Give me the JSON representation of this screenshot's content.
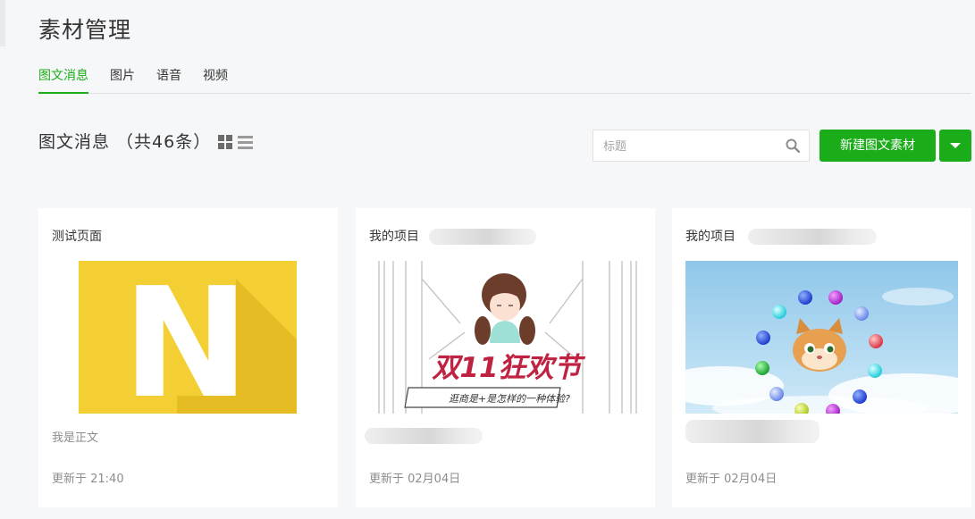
{
  "header": {
    "title": "素材管理"
  },
  "tabs": [
    {
      "label": "图文消息",
      "active": true
    },
    {
      "label": "图片",
      "active": false
    },
    {
      "label": "语音",
      "active": false
    },
    {
      "label": "视频",
      "active": false
    }
  ],
  "section": {
    "title": "图文消息 （共46条）"
  },
  "search": {
    "placeholder": "标题",
    "value": ""
  },
  "toolbar": {
    "new_label": "新建图文素材"
  },
  "colors": {
    "accent": "#1aad19"
  },
  "icons": {
    "grid": "grid-view-icon",
    "list": "list-view-icon",
    "search": "search-icon",
    "dropdown": "caret-down-icon"
  },
  "cards": [
    {
      "title": "测试页面",
      "digest": "我是正文",
      "time": "更新于 21:40",
      "cover_letter": "N"
    },
    {
      "title": "我的项目",
      "digest": "",
      "time": "更新于 02月04日",
      "cover_text": "双11狂欢节",
      "cover_subtext": "逛商是+是怎样的一种体验?"
    },
    {
      "title": "我的项目",
      "digest": "",
      "time": "更新于 02月04日"
    }
  ]
}
